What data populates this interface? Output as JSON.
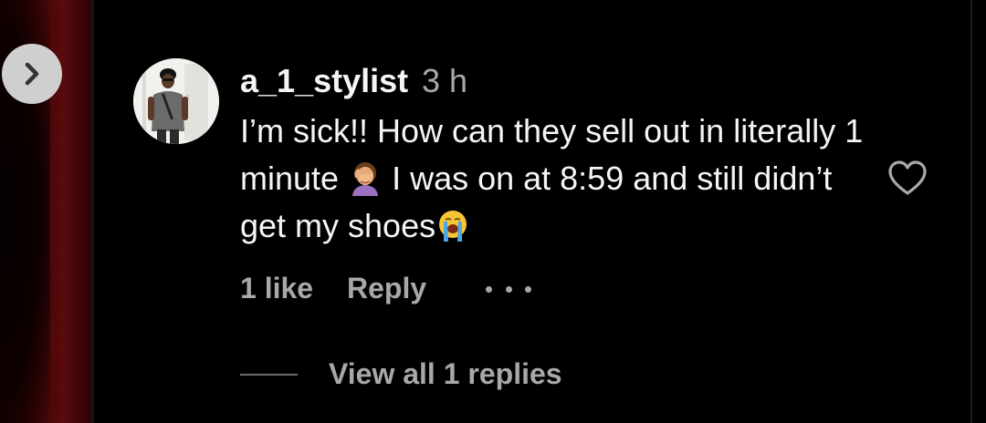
{
  "comment": {
    "username": "a_1_stylist",
    "time": "3 h",
    "text_part1": "I’m sick!! How can they sell out in literally 1 minute ",
    "emoji1": "face-palm",
    "text_part2": " I was on at 8:59 and still didn’t get my shoes",
    "emoji2": "loudly-crying-face",
    "likes": "1 like",
    "reply_label": "Reply",
    "view_replies": "View all 1 replies"
  },
  "icons": {
    "nav": "chevron-right-icon",
    "like": "heart-outline-icon",
    "more": "more-options-icon"
  },
  "colors": {
    "background": "#000000",
    "text_primary": "#f5f5f5",
    "text_secondary": "#a8a8a8",
    "nav_button": "#cfcfcf"
  }
}
